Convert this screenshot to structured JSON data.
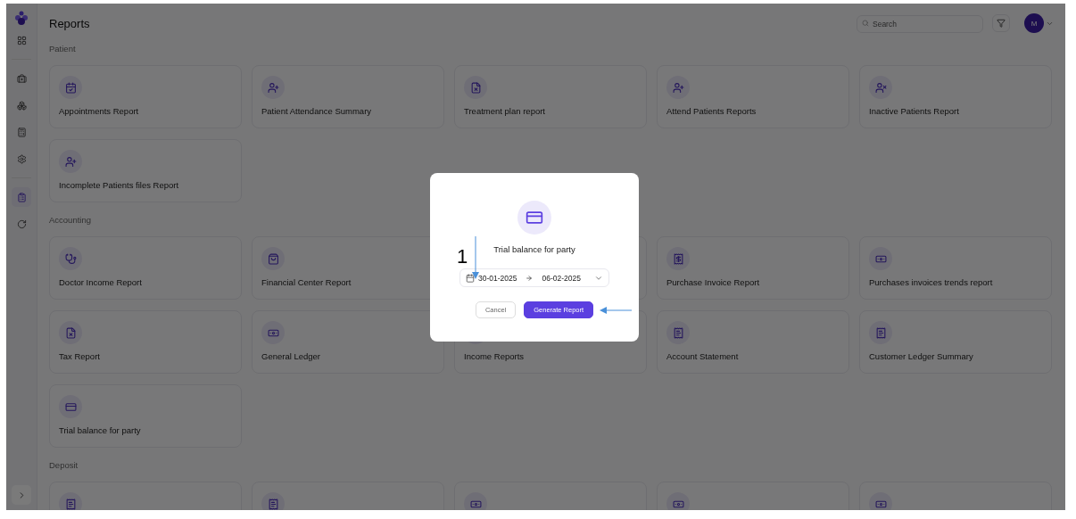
{
  "header": {
    "title": "Reports",
    "search": {
      "placeholder": "Search"
    },
    "avatar": "M"
  },
  "sections": [
    {
      "title": "Patient",
      "cards": [
        {
          "label": "Appointments Report"
        },
        {
          "label": "Patient Attendance Summary"
        },
        {
          "label": "Treatment plan report"
        },
        {
          "label": "Attend Patients Reports"
        },
        {
          "label": "Inactive Patients Report"
        },
        {
          "label": "Incomplete Patients files Report"
        }
      ]
    },
    {
      "title": "Accounting",
      "cards": [
        {
          "label": "Doctor Income Report"
        },
        {
          "label": "Financial Center Report"
        },
        {
          "kind": "covered"
        },
        {
          "label": "Purchase Invoice Report"
        },
        {
          "label": "Purchases invoices trends report"
        },
        {
          "label": "Tax Report"
        },
        {
          "label": "General Ledger"
        },
        {
          "label": "Income Reports"
        },
        {
          "label": "Account Statement"
        },
        {
          "label": "Customer Ledger Summary"
        },
        {
          "label": "Trial balance for party"
        }
      ]
    },
    {
      "title": "Deposit",
      "cards": [
        {
          "kind": "icon_only"
        },
        {
          "kind": "icon_only"
        },
        {
          "kind": "icon_only"
        },
        {
          "kind": "icon_only"
        },
        {
          "kind": "icon_only"
        }
      ]
    }
  ],
  "sidebar": {
    "items": [
      {
        "selected": false
      },
      {
        "selected": false
      },
      {
        "selected": false
      },
      {
        "selected": false
      },
      {
        "selected": false
      },
      {
        "selected": true
      },
      {
        "selected": false
      }
    ]
  },
  "modal": {
    "title": "Trial balance for party",
    "date_from": "30-01-2025",
    "date_to": "06-02-2025",
    "buttons": [
      {
        "label": "Cancel",
        "kind": "secondary"
      },
      {
        "label": "Generate Report",
        "kind": "primary"
      }
    ]
  },
  "annotation": {
    "label": "1"
  }
}
